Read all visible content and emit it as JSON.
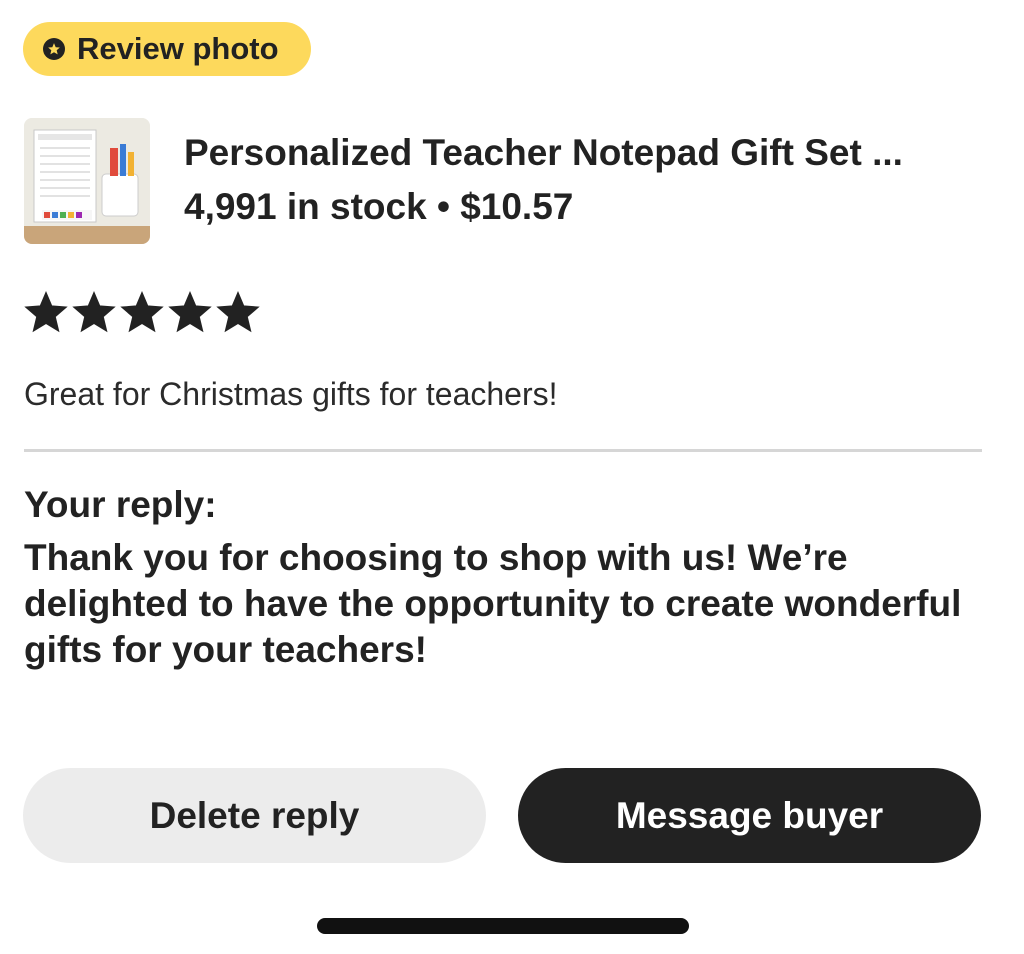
{
  "badge": {
    "label": "Review photo",
    "icon": "star-badge-icon",
    "color": "#fdd95c"
  },
  "product": {
    "thumbnail": "teacher-notepad-gift-set-thumbnail",
    "title": "Personalized Teacher Notepad Gift Set  ...",
    "stock_price": "4,991 in stock • $10.57"
  },
  "review": {
    "rating": 5,
    "rating_max": 5,
    "text": "Great for Christmas gifts for teachers!"
  },
  "reply": {
    "label": "Your reply:",
    "text": "Thank you for choosing to shop with us! We’re delighted to have the opportunity to create wonderful gifts for your teachers!"
  },
  "actions": {
    "delete_label": "Delete reply",
    "message_label": "Message buyer"
  }
}
